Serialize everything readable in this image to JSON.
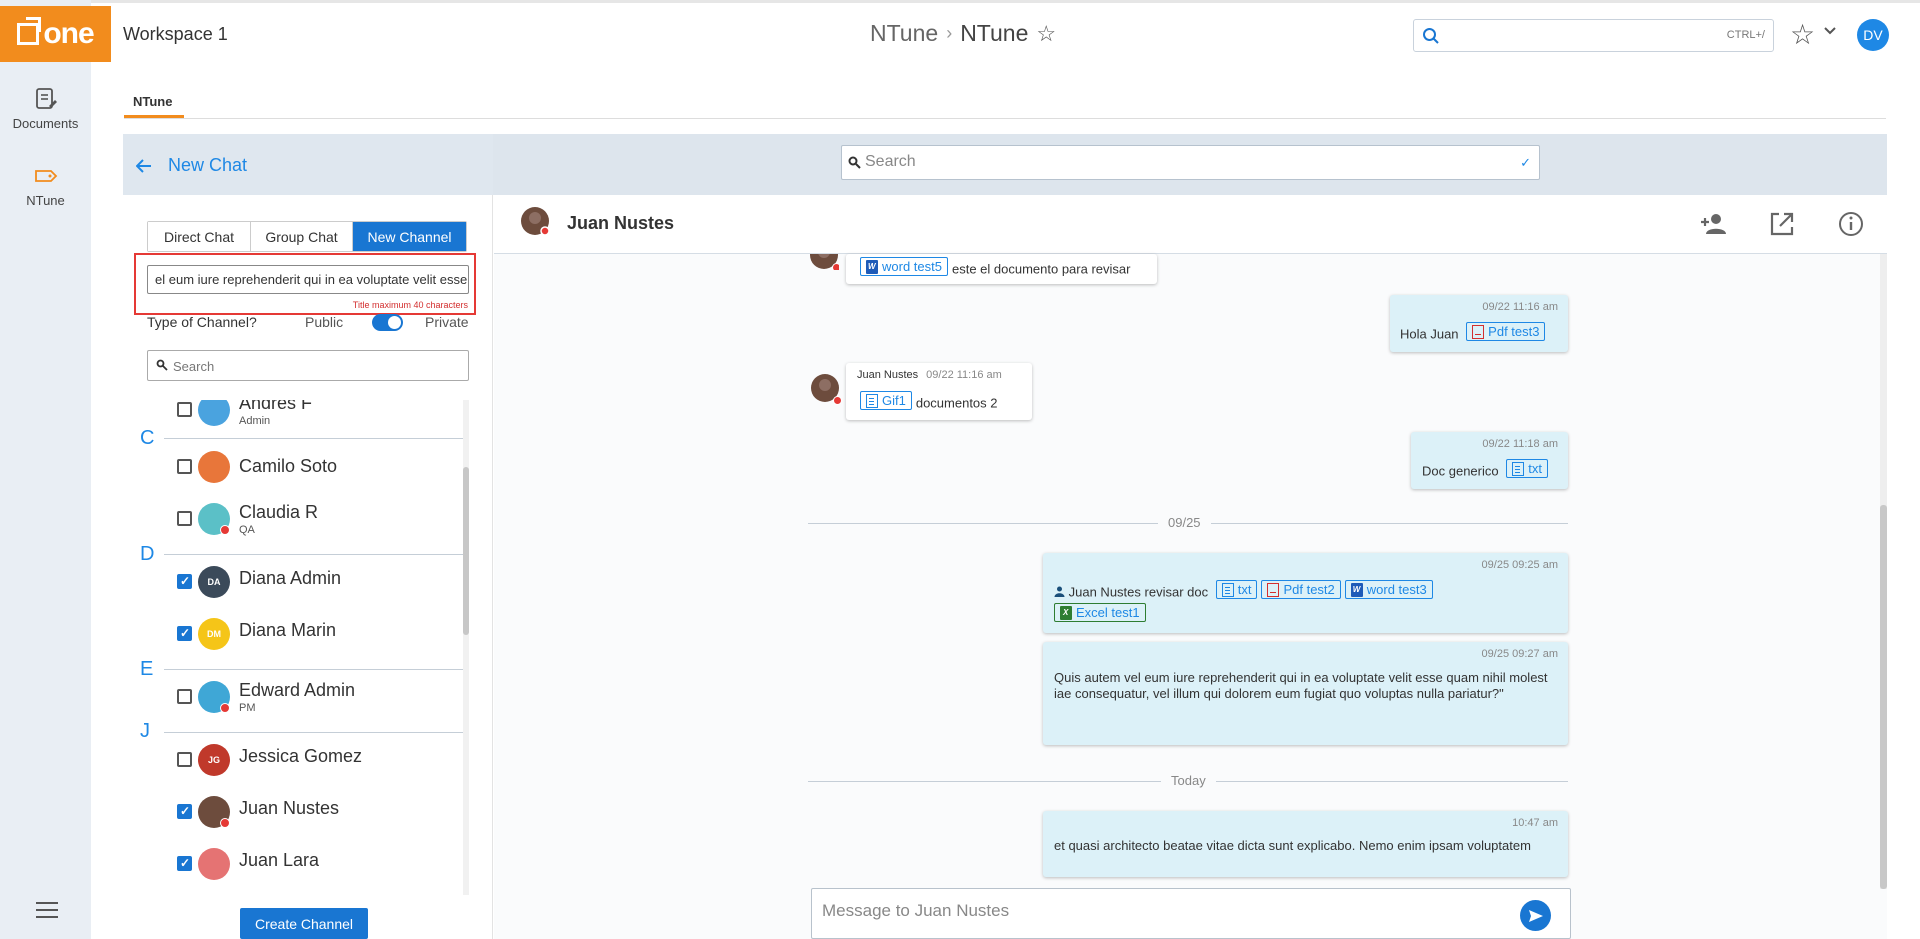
{
  "app": {
    "logo_text": "one",
    "workspace": "Workspace 1"
  },
  "rail": {
    "items": [
      {
        "label": "Documents"
      },
      {
        "label": "NTune"
      }
    ]
  },
  "header": {
    "breadcrumb_parent": "NTune",
    "breadcrumb_current": "NTune",
    "search_shortcut": "CTRL+/",
    "user_initials": "DV"
  },
  "app_tab": "NTune",
  "chat_bar": {
    "back_label": "New Chat",
    "search_placeholder": "Search"
  },
  "new_chat": {
    "tabs": [
      {
        "label": "Direct Chat"
      },
      {
        "label": "Group Chat"
      },
      {
        "label": "New Channel",
        "active": true
      }
    ],
    "title_value": "el eum iure reprehenderit qui in ea voluptate velit esse",
    "title_hint": "Title maximum 40 characters",
    "type_label": "Type of Channel?",
    "public_label": "Public",
    "private_label": "Private",
    "channel_private": true,
    "search_placeholder": "Search",
    "letters": [
      "C",
      "D",
      "E",
      "J"
    ],
    "contacts": [
      {
        "name": "Andres F",
        "role": "Admin",
        "checked": false
      },
      {
        "name": "Camilo Soto",
        "role": "",
        "checked": false
      },
      {
        "name": "Claudia R",
        "role": "QA",
        "checked": false
      },
      {
        "name": "Diana Admin",
        "role": "",
        "checked": true,
        "initials": "DA"
      },
      {
        "name": "Diana Marin",
        "role": "",
        "checked": true,
        "initials": "DM"
      },
      {
        "name": "Edward Admin",
        "role": "PM",
        "checked": false
      },
      {
        "name": "Jessica Gomez",
        "role": "",
        "checked": false,
        "initials": "JG"
      },
      {
        "name": "Juan Nustes",
        "role": "",
        "checked": true
      },
      {
        "name": "Juan Lara",
        "role": "",
        "checked": true
      }
    ],
    "create_button": "Create Channel"
  },
  "conversation": {
    "contact_name": "Juan Nustes",
    "messages": {
      "m1": {
        "chip": "word test5",
        "text": "este el documento para revisar"
      },
      "m2": {
        "time": "09/22 11:16 am",
        "text": "Hola Juan",
        "chip": "Pdf test3"
      },
      "m3": {
        "sender": "Juan Nustes",
        "time": "09/22 11:16 am",
        "chip": "Gif1",
        "text": "documentos 2"
      },
      "m4": {
        "time": "09/22 11:18 am",
        "text": "Doc generico",
        "chip": "txt"
      },
      "m5": {
        "time": "09/25 09:25 am",
        "mention": "Juan Nustes",
        "text": "revisar doc",
        "chips": [
          "txt",
          "Pdf test2",
          "word test3",
          "Excel test1"
        ]
      },
      "m6": {
        "time": "09/25 09:27 am",
        "text": "Quis autem vel eum iure reprehenderit qui in ea voluptate velit esse quam nihil molestiae consequatur, vel illum qui dolorem eum fugiat quo voluptas nulla pariatur?\""
      },
      "m7": {
        "time": "10:47 am",
        "text": "et quasi architecto beatae vitae dicta sunt explicabo. Nemo enim ipsam voluptatem"
      }
    },
    "dividers": [
      "09/25",
      "Today"
    ],
    "composer_placeholder": "Message to Juan Nustes"
  },
  "colors": {
    "brand": "#f28c1d",
    "accent": "#1976d2",
    "error": "#e53935"
  }
}
